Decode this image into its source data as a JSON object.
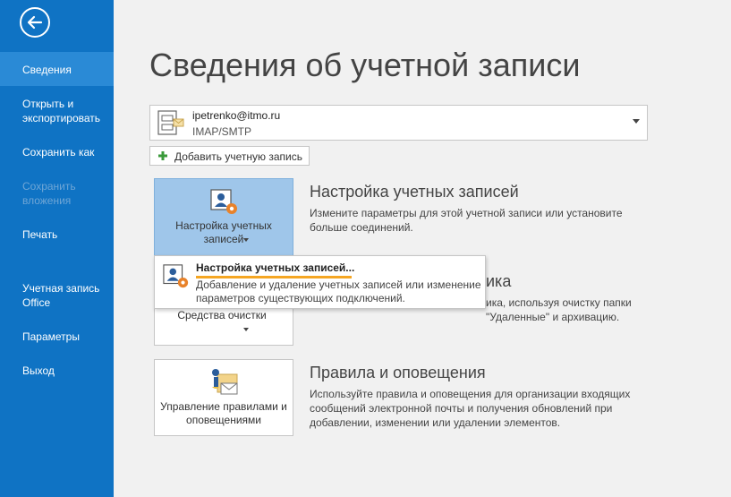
{
  "sidebar": {
    "items": [
      {
        "label": "Сведения"
      },
      {
        "label": "Открыть и экспортировать"
      },
      {
        "label": "Сохранить как"
      },
      {
        "label": "Сохранить вложения"
      },
      {
        "label": "Печать"
      },
      {
        "label": "Учетная запись Office"
      },
      {
        "label": "Параметры"
      },
      {
        "label": "Выход"
      }
    ]
  },
  "page": {
    "title": "Сведения об учетной записи"
  },
  "account": {
    "email": "ipetrenko@itmo.ru",
    "type": "IMAP/SMTP"
  },
  "add_account": {
    "label": "Добавить учетную запись"
  },
  "sections": {
    "account_settings": {
      "tile_label": "Настройка учетных записей",
      "title": "Настройка учетных записей",
      "desc": "Измените параметры для этой учетной записи или установите больше соединений."
    },
    "cleanup": {
      "tile_label": "Средства очистки",
      "title_partial": "ика",
      "desc_partial": "ика, используя очистку папки \"Удаленные\" и архивацию."
    },
    "rules": {
      "tile_label": "Управление правилами и оповещениями",
      "title": "Правила и оповещения",
      "desc": "Используйте правила и оповещения для организации входящих сообщений электронной почты и получения обновлений при добавлении, изменении или удалении элементов."
    }
  },
  "popup": {
    "title": "Настройка учетных записей...",
    "desc": "Добавление и удаление учетных записей или изменение параметров существующих подключений."
  },
  "colors": {
    "sidebar": "#0f73c4",
    "active": "#2a8ad6",
    "accent": "#f5a623"
  }
}
